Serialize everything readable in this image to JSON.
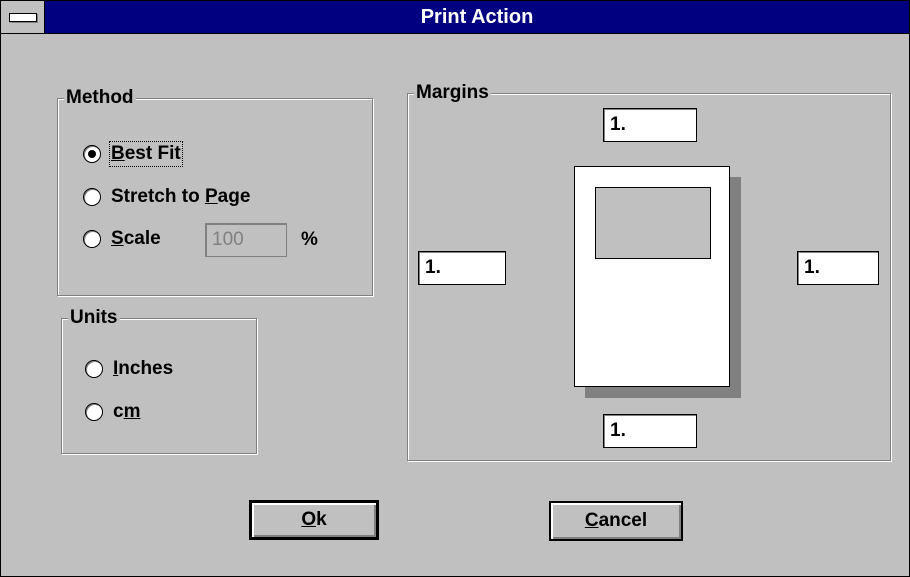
{
  "window": {
    "title": "Print Action"
  },
  "method": {
    "legend": "Method",
    "options": [
      {
        "label": "Best Fit",
        "mnemonic": "B",
        "selected": true
      },
      {
        "label": "Stretch to Page",
        "mnemonic": "P",
        "selected": false
      },
      {
        "label": "Scale",
        "mnemonic": "S",
        "selected": false
      }
    ],
    "scale_value": "100",
    "scale_unit": "%"
  },
  "units": {
    "legend": "Units",
    "options": [
      {
        "label": "Inches",
        "mnemonic": "I",
        "selected": false
      },
      {
        "label": "cm",
        "mnemonic": "m",
        "selected": false
      }
    ]
  },
  "margins": {
    "legend": "Margins",
    "top": "1.",
    "left": "1.",
    "right": "1.",
    "bottom": "1."
  },
  "buttons": {
    "ok": "Ok",
    "cancel": "Cancel"
  },
  "colors": {
    "titlebar": "#000080",
    "face": "#c0c0c0"
  }
}
